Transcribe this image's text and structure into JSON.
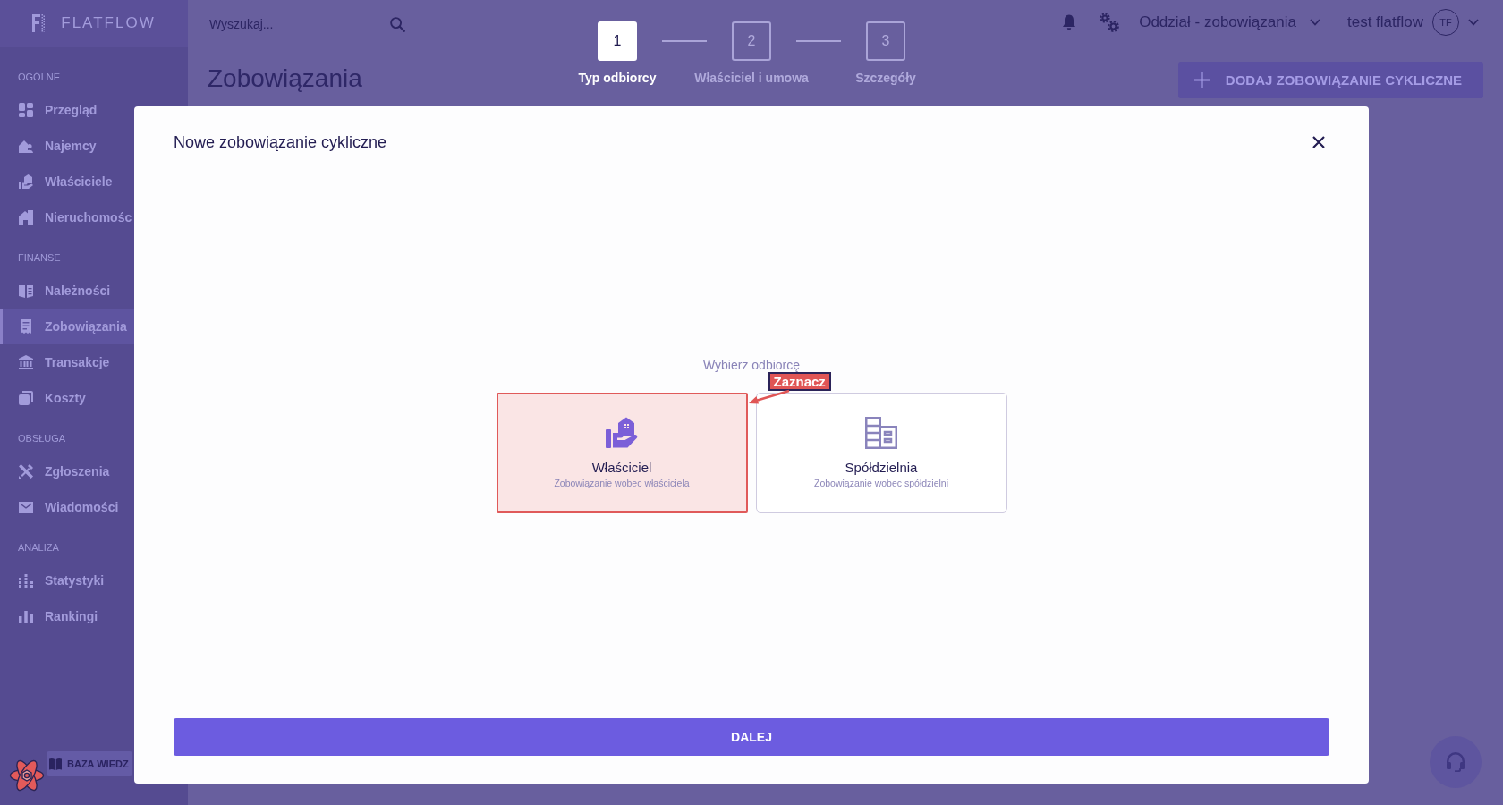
{
  "sidebar": {
    "logo": "FLATFLOW",
    "sections": [
      {
        "title": "OGÓLNE",
        "items": [
          {
            "label": "Przegląd",
            "selected": false
          },
          {
            "label": "Najemcy",
            "selected": false
          },
          {
            "label": "Właściciele",
            "selected": false
          },
          {
            "label": "Nieruchomośc",
            "selected": false
          }
        ]
      },
      {
        "title": "FINANSE",
        "items": [
          {
            "label": "Należności",
            "selected": false
          },
          {
            "label": "Zobowiązania",
            "selected": true
          },
          {
            "label": "Transakcje",
            "selected": false
          },
          {
            "label": "Koszty",
            "selected": false
          }
        ]
      },
      {
        "title": "OBSŁUGA",
        "items": [
          {
            "label": "Zgłoszenia",
            "selected": false
          },
          {
            "label": "Wiadomości",
            "selected": false
          }
        ]
      },
      {
        "title": "ANALIZA",
        "items": [
          {
            "label": "Statystyki",
            "selected": false
          },
          {
            "label": "Rankingi",
            "selected": false
          }
        ]
      }
    ],
    "knowledge_base_button": "BAZA WIEDZ"
  },
  "header": {
    "search": {
      "placeholder": "Wyszukaj..."
    },
    "page_title": "Zobowiązania",
    "branch_selector": "Oddział - zobowiązania",
    "user_name": "test flatflow",
    "avatar_initials": "TF",
    "add_button": "DODAJ ZOBOWIĄZANIE CYKLICZNE"
  },
  "stepper": {
    "steps": [
      {
        "number": "1",
        "label": "Typ odbiorcy",
        "selected": true
      },
      {
        "number": "2",
        "label": "Właściciel i umowa",
        "selected": false
      },
      {
        "number": "3",
        "label": "Szczegóły",
        "selected": false
      }
    ]
  },
  "modal": {
    "title": "Nowe zobowiązanie cykliczne",
    "prompt": "Wybierz odbiorcę",
    "options": [
      {
        "title": "Właściciel",
        "subtitle": "Zobowiązanie wobec właściciela",
        "selected": true
      },
      {
        "title": "Spółdzielnia",
        "subtitle": "Zobowiązanie wobec spółdzielni",
        "selected": false
      }
    ],
    "annotation": "Zaznacz",
    "next_button": "DALEJ"
  }
}
